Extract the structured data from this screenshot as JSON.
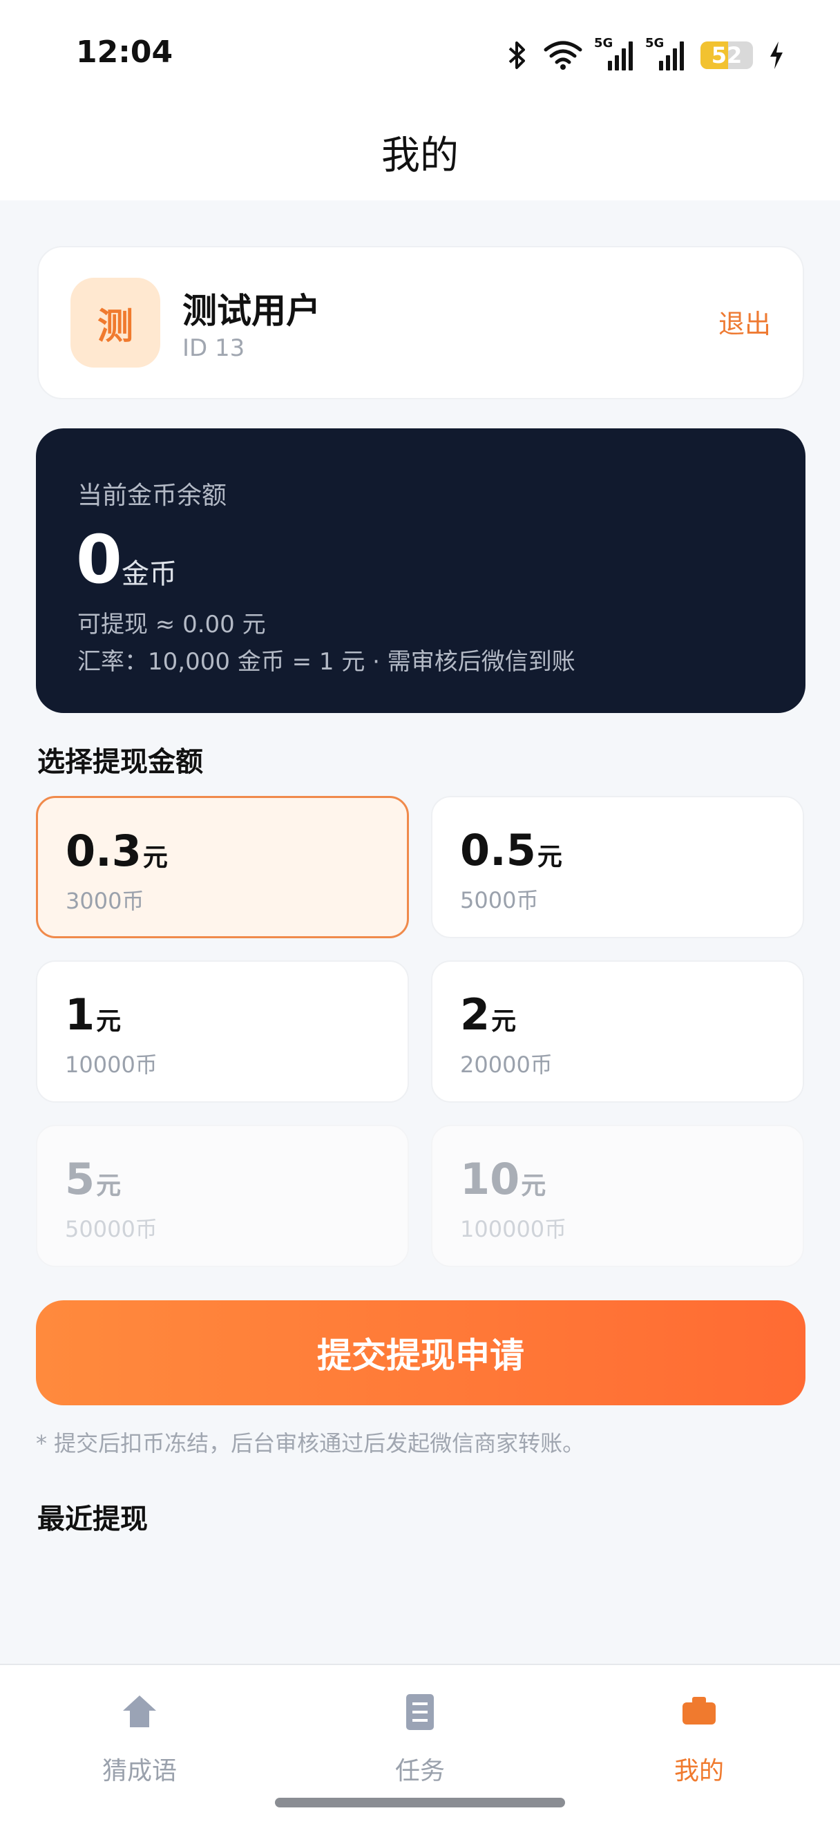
{
  "status": {
    "time": "12:04",
    "network1": "5G",
    "network2": "5G",
    "battery": "52",
    "battery_level": 0.52
  },
  "header": {
    "title": "我的"
  },
  "user": {
    "avatar_text": "测",
    "name": "测试用户",
    "id": "ID 13",
    "logout": "退出"
  },
  "balance": {
    "label": "当前金币余额",
    "amount": "0",
    "unit": "金币",
    "withdrawable": "可提现 ≈ 0.00 元",
    "rate": "汇率：10,000 金币 = 1 元 · 需审核后微信到账"
  },
  "withdraw": {
    "section_title": "选择提现金额",
    "yuan": "元",
    "options": [
      {
        "amount": "0.3",
        "coins": "3000币",
        "state": "selected"
      },
      {
        "amount": "0.5",
        "coins": "5000币",
        "state": "normal"
      },
      {
        "amount": "1",
        "coins": "10000币",
        "state": "normal"
      },
      {
        "amount": "2",
        "coins": "20000币",
        "state": "normal"
      },
      {
        "amount": "5",
        "coins": "50000币",
        "state": "disabled"
      },
      {
        "amount": "10",
        "coins": "100000币",
        "state": "disabled"
      }
    ],
    "submit_label": "提交提现申请",
    "note": "* 提交后扣币冻结，后台审核通过后发起微信商家转账。"
  },
  "recent": {
    "title": "最近提现"
  },
  "tabs": [
    {
      "label": "猜成语",
      "icon": "home-icon",
      "active": false
    },
    {
      "label": "任务",
      "icon": "task-list-icon",
      "active": false
    },
    {
      "label": "我的",
      "icon": "wallet-icon",
      "active": true
    }
  ],
  "colors": {
    "accent": "#f07a2e",
    "dark_card": "#111a2e",
    "inactive": "#9aa1ac"
  }
}
